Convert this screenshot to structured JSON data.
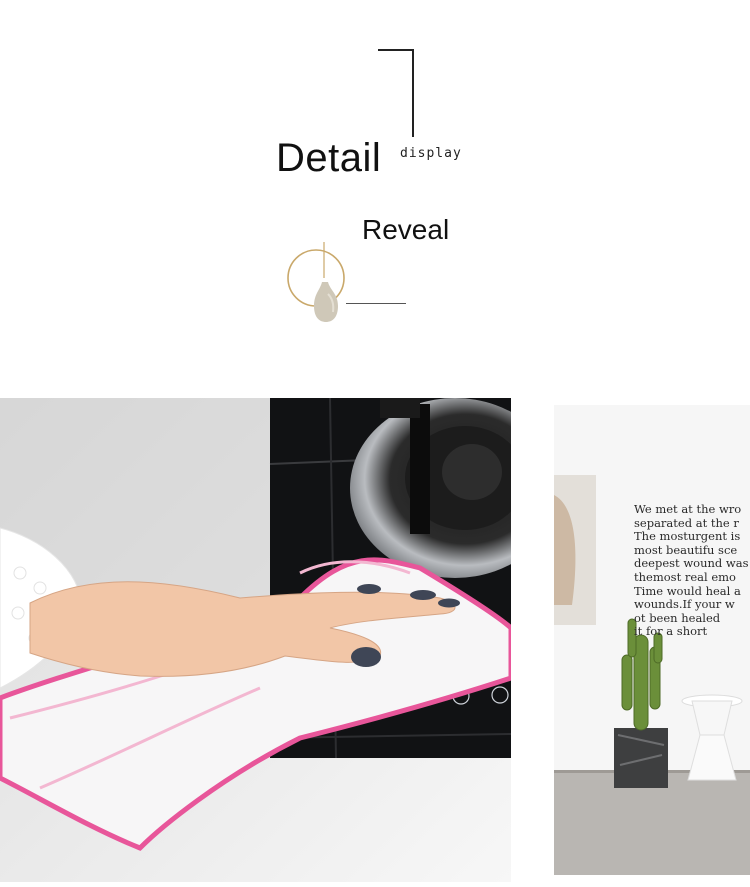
{
  "header": {
    "title": "Detail",
    "subtitle": "display",
    "reveal": "Reveal"
  },
  "wall_text": {
    "lines": [
      "We met at the wro",
      "separated at the r",
      "The mosturgent is",
      "most beautifu sce",
      "deepest wound was",
      "themost real emo",
      "Time would heal a",
      "wounds.If your w",
      "ot been healed ",
      "it for a short"
    ]
  },
  "icons": {
    "vase": "vase-ring-ornament-icon",
    "touch_controls": [
      "power-icon",
      "timer-icon",
      "flame-icon",
      "lock-icon"
    ]
  },
  "colors": {
    "towel_edge": "#e8569a",
    "nail_polish": "#3f4656",
    "cooktop": "#111214"
  }
}
